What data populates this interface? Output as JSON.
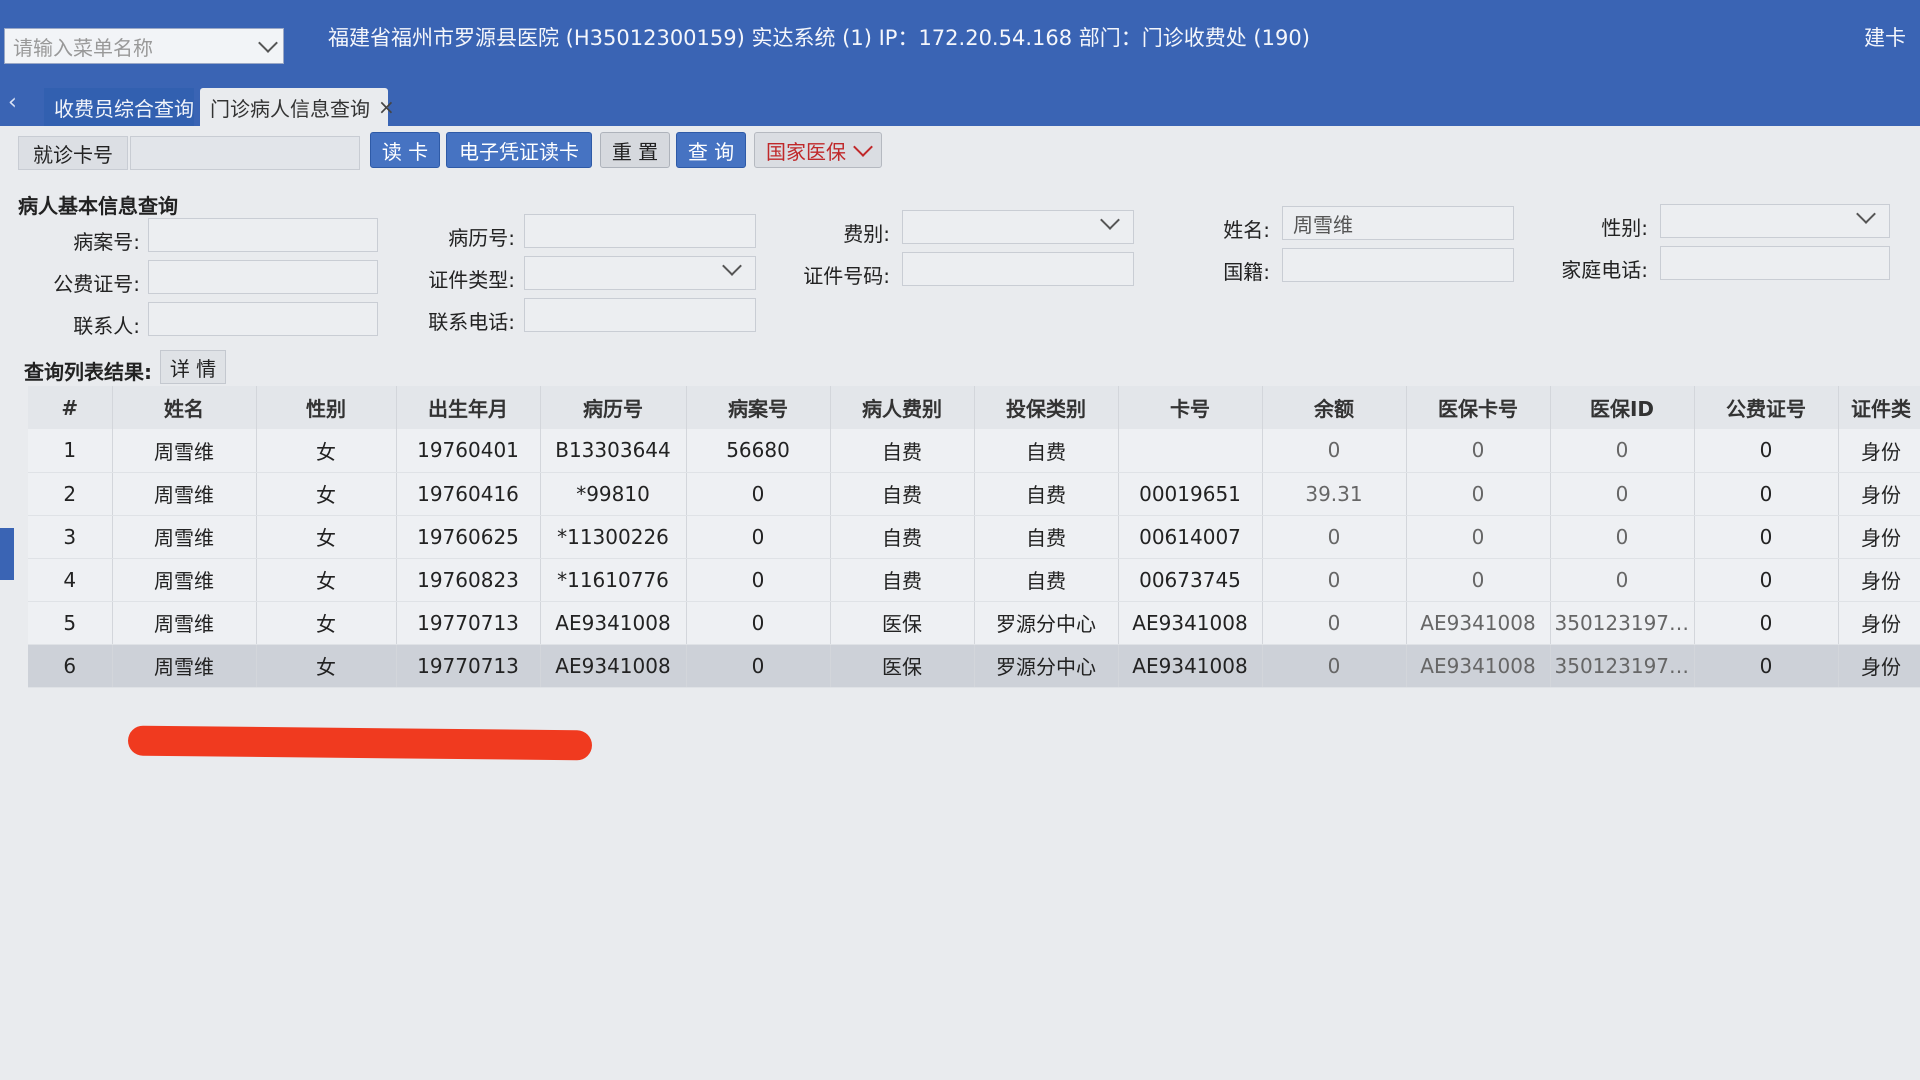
{
  "header": {
    "menu_search_placeholder": "请输入菜单名称",
    "system_title": "福建省福州市罗源县医院 (H35012300159) 实达系统 (1) IP：172.20.54.168 部门：门诊收费处 (190)",
    "right_action": "建卡"
  },
  "tabs": [
    {
      "label": "收费员综合查询"
    },
    {
      "label": "门诊病人信息查询",
      "close": "×"
    }
  ],
  "toolbar": {
    "card_label": "就诊卡号",
    "read_card": "读 卡",
    "e_voucher": "电子凭证读卡",
    "reset": "重 置",
    "query": "查 询",
    "national_insurance": "国家医保"
  },
  "form": {
    "section_title": "病人基本信息查询",
    "case_no_label": "病案号:",
    "record_no_label": "病历号:",
    "fee_type_label": "费别:",
    "name_label": "姓名:",
    "name_value": "周雪维",
    "gender_label": "性别:",
    "public_fee_label": "公费证号:",
    "id_type_label": "证件类型:",
    "id_no_label": "证件号码:",
    "nationality_label": "国籍:",
    "home_phone_label": "家庭电话:",
    "contact_label": "联系人:",
    "contact_phone_label": "联系电话:"
  },
  "results": {
    "label": "查询列表结果:",
    "detail_button": "详 情",
    "columns": [
      "#",
      "姓名",
      "性别",
      "出生年月",
      "病历号",
      "病案号",
      "病人费别",
      "投保类别",
      "卡号",
      "余额",
      "医保卡号",
      "医保ID",
      "公费证号",
      "证件类"
    ],
    "rows": [
      [
        "1",
        "周雪维",
        "女",
        "19760401",
        "B13303644",
        "56680",
        "自费",
        "自费",
        "",
        "0",
        "0",
        "0",
        "0",
        "身份"
      ],
      [
        "2",
        "周雪维",
        "女",
        "19760416",
        "*99810",
        "0",
        "自费",
        "自费",
        "00019651",
        "39.31",
        "0",
        "0",
        "0",
        "身份"
      ],
      [
        "3",
        "周雪维",
        "女",
        "19760625",
        "*11300226",
        "0",
        "自费",
        "自费",
        "00614007",
        "0",
        "0",
        "0",
        "0",
        "身份"
      ],
      [
        "4",
        "周雪维",
        "女",
        "19760823",
        "*11610776",
        "0",
        "自费",
        "自费",
        "00673745",
        "0",
        "0",
        "0",
        "0",
        "身份"
      ],
      [
        "5",
        "周雪维",
        "女",
        "19770713",
        "AE9341008",
        "0",
        "医保",
        "罗源分中心",
        "AE9341008",
        "0",
        "AE9341008",
        "3501231977...",
        "0",
        "身份"
      ],
      [
        "6",
        "周雪维",
        "女",
        "19770713",
        "AE9341008",
        "0",
        "医保",
        "罗源分中心",
        "AE9341008",
        "0",
        "AE9341008",
        "3501231977...",
        "0",
        "身份"
      ]
    ],
    "selected_row": 6
  },
  "colors": {
    "header_blue": "#3a64b4",
    "button_blue": "#4673c2",
    "annotation_red": "#f03a1f"
  }
}
